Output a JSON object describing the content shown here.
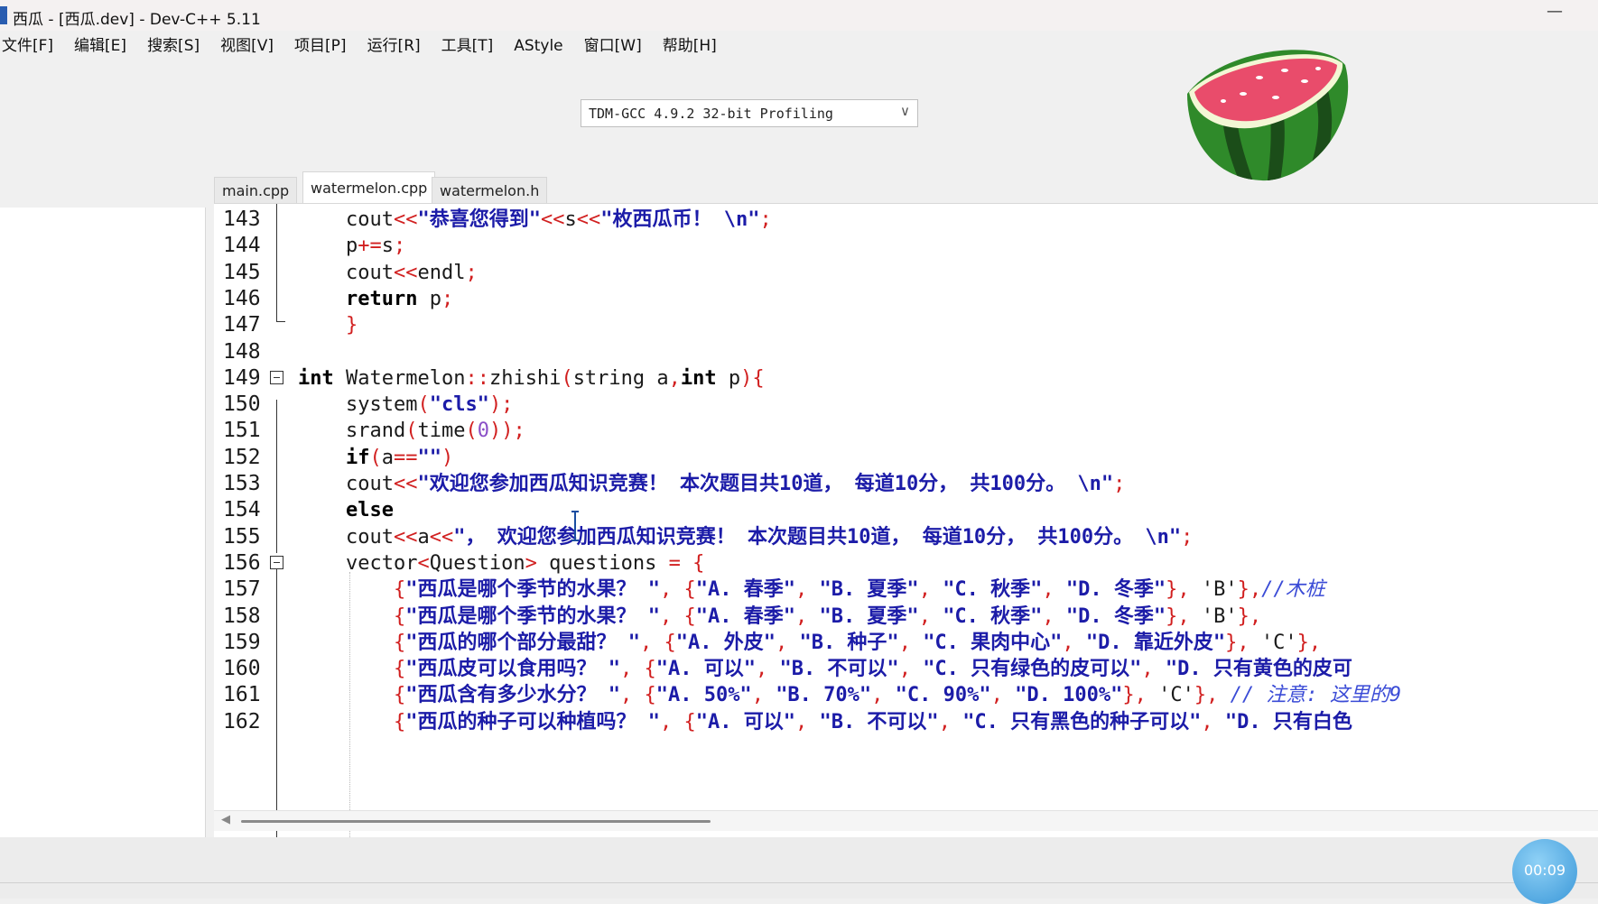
{
  "window": {
    "title": "西瓜 - [西瓜.dev] - Dev-C++ 5.11",
    "minimize": "—"
  },
  "menu": [
    "文件[F]",
    "编辑[E]",
    "搜索[S]",
    "视图[V]",
    "项目[P]",
    "运行[R]",
    "工具[T]",
    "AStyle",
    "窗口[W]",
    "帮助[H]"
  ],
  "compiler": {
    "selected": "TDM-GCC 4.9.2 32-bit Profiling",
    "arrow": "∨"
  },
  "tabs": [
    {
      "label": "main.cpp",
      "active": false
    },
    {
      "label": "watermelon.cpp",
      "active": true
    },
    {
      "label": "watermelon.h",
      "active": false
    }
  ],
  "code": [
    {
      "n": "143",
      "tokens": [
        [
          "t-id",
          "    cout"
        ],
        [
          "t-op",
          "<<"
        ],
        [
          "t-str",
          "\"恭喜您得到\""
        ],
        [
          "t-op",
          "<<"
        ],
        [
          "t-id",
          "s"
        ],
        [
          "t-op",
          "<<"
        ],
        [
          "t-str",
          "\"枚西瓜币！ \\n\""
        ],
        [
          "t-op",
          ";"
        ]
      ]
    },
    {
      "n": "144",
      "tokens": [
        [
          "t-id",
          "    p"
        ],
        [
          "t-op",
          "+="
        ],
        [
          "t-id",
          "s"
        ],
        [
          "t-op",
          ";"
        ]
      ]
    },
    {
      "n": "145",
      "tokens": [
        [
          "t-id",
          "    cout"
        ],
        [
          "t-op",
          "<<"
        ],
        [
          "t-id",
          "endl"
        ],
        [
          "t-op",
          ";"
        ]
      ]
    },
    {
      "n": "146",
      "tokens": [
        [
          "t-kw",
          "    return"
        ],
        [
          "t-id",
          " p"
        ],
        [
          "t-op",
          ";"
        ]
      ]
    },
    {
      "n": "147",
      "tokens": [
        [
          "t-op",
          "    }"
        ]
      ]
    },
    {
      "n": "148",
      "tokens": []
    },
    {
      "n": "149",
      "tokens": [
        [
          "t-kw",
          "int"
        ],
        [
          "t-id",
          " Watermelon"
        ],
        [
          "t-op",
          "::"
        ],
        [
          "t-id",
          "zhishi"
        ],
        [
          "t-op",
          "("
        ],
        [
          "t-id",
          "string a"
        ],
        [
          "t-op",
          ","
        ],
        [
          "t-kw",
          "int"
        ],
        [
          "t-id",
          " p"
        ],
        [
          "t-op",
          "){"
        ]
      ]
    },
    {
      "n": "150",
      "tokens": [
        [
          "t-id",
          "    system"
        ],
        [
          "t-op",
          "("
        ],
        [
          "t-str",
          "\"cls\""
        ],
        [
          "t-op",
          ");"
        ]
      ]
    },
    {
      "n": "151",
      "tokens": [
        [
          "t-id",
          "    srand"
        ],
        [
          "t-op",
          "("
        ],
        [
          "t-id",
          "time"
        ],
        [
          "t-op",
          "("
        ],
        [
          "t-num",
          "0"
        ],
        [
          "t-op",
          "));"
        ]
      ]
    },
    {
      "n": "152",
      "tokens": [
        [
          "t-kw",
          "    if"
        ],
        [
          "t-op",
          "("
        ],
        [
          "t-id",
          "a"
        ],
        [
          "t-op",
          "=="
        ],
        [
          "t-str",
          "\"\""
        ],
        [
          "t-op",
          ")"
        ]
      ]
    },
    {
      "n": "153",
      "tokens": [
        [
          "t-id",
          "    cout"
        ],
        [
          "t-op",
          "<<"
        ],
        [
          "t-str",
          "\"欢迎您参加西瓜知识竞赛！ 本次题目共10道， 每道10分， 共100分。 \\n\""
        ],
        [
          "t-op",
          ";"
        ]
      ]
    },
    {
      "n": "154",
      "tokens": [
        [
          "t-kw",
          "    else"
        ]
      ]
    },
    {
      "n": "155",
      "tokens": [
        [
          "t-id",
          "    cout"
        ],
        [
          "t-op",
          "<<"
        ],
        [
          "t-id",
          "a"
        ],
        [
          "t-op",
          "<<"
        ],
        [
          "t-str",
          "\"， 欢迎您参加西瓜知识竞赛！ 本次题目共10道， 每道10分， 共100分。 \\n\""
        ],
        [
          "t-op",
          ";"
        ]
      ]
    },
    {
      "n": "156",
      "tokens": [
        [
          "t-id",
          "    vector"
        ],
        [
          "t-op",
          "<"
        ],
        [
          "t-id",
          "Question"
        ],
        [
          "t-op",
          ">"
        ],
        [
          "t-id",
          " questions "
        ],
        [
          "t-op",
          "= {"
        ]
      ]
    },
    {
      "n": "157",
      "tokens": [
        [
          "t-op",
          "        {"
        ],
        [
          "t-str",
          "\"西瓜是哪个季节的水果？ \""
        ],
        [
          "t-op",
          ", {"
        ],
        [
          "t-str",
          "\"A. 春季\""
        ],
        [
          "t-op",
          ", "
        ],
        [
          "t-str",
          "\"B. 夏季\""
        ],
        [
          "t-op",
          ", "
        ],
        [
          "t-str",
          "\"C. 秋季\""
        ],
        [
          "t-op",
          ", "
        ],
        [
          "t-str",
          "\"D. 冬季\""
        ],
        [
          "t-op",
          "}, "
        ],
        [
          "t-id",
          "'B'"
        ],
        [
          "t-op",
          "},"
        ],
        [
          "t-cmt",
          "//木桩"
        ]
      ]
    },
    {
      "n": "158",
      "tokens": [
        [
          "t-op",
          "        {"
        ],
        [
          "t-str",
          "\"西瓜是哪个季节的水果？ \""
        ],
        [
          "t-op",
          ", {"
        ],
        [
          "t-str",
          "\"A. 春季\""
        ],
        [
          "t-op",
          ", "
        ],
        [
          "t-str",
          "\"B. 夏季\""
        ],
        [
          "t-op",
          ", "
        ],
        [
          "t-str",
          "\"C. 秋季\""
        ],
        [
          "t-op",
          ", "
        ],
        [
          "t-str",
          "\"D. 冬季\""
        ],
        [
          "t-op",
          "}, "
        ],
        [
          "t-id",
          "'B'"
        ],
        [
          "t-op",
          "},"
        ]
      ]
    },
    {
      "n": "159",
      "tokens": [
        [
          "t-op",
          "        {"
        ],
        [
          "t-str",
          "\"西瓜的哪个部分最甜？ \""
        ],
        [
          "t-op",
          ", {"
        ],
        [
          "t-str",
          "\"A. 外皮\""
        ],
        [
          "t-op",
          ", "
        ],
        [
          "t-str",
          "\"B. 种子\""
        ],
        [
          "t-op",
          ", "
        ],
        [
          "t-str",
          "\"C. 果肉中心\""
        ],
        [
          "t-op",
          ", "
        ],
        [
          "t-str",
          "\"D. 靠近外皮\""
        ],
        [
          "t-op",
          "}, "
        ],
        [
          "t-id",
          "'C'"
        ],
        [
          "t-op",
          "},"
        ]
      ]
    },
    {
      "n": "160",
      "tokens": [
        [
          "t-op",
          "        {"
        ],
        [
          "t-str",
          "\"西瓜皮可以食用吗？ \""
        ],
        [
          "t-op",
          ", {"
        ],
        [
          "t-str",
          "\"A. 可以\""
        ],
        [
          "t-op",
          ", "
        ],
        [
          "t-str",
          "\"B. 不可以\""
        ],
        [
          "t-op",
          ", "
        ],
        [
          "t-str",
          "\"C. 只有绿色的皮可以\""
        ],
        [
          "t-op",
          ", "
        ],
        [
          "t-str",
          "\"D. 只有黄色的皮可"
        ]
      ]
    },
    {
      "n": "161",
      "tokens": [
        [
          "t-op",
          "        {"
        ],
        [
          "t-str",
          "\"西瓜含有多少水分？ \""
        ],
        [
          "t-op",
          ", {"
        ],
        [
          "t-str",
          "\"A. 50%\""
        ],
        [
          "t-op",
          ", "
        ],
        [
          "t-str",
          "\"B. 70%\""
        ],
        [
          "t-op",
          ", "
        ],
        [
          "t-str",
          "\"C. 90%\""
        ],
        [
          "t-op",
          ", "
        ],
        [
          "t-str",
          "\"D. 100%\""
        ],
        [
          "t-op",
          "}, "
        ],
        [
          "t-id",
          "'C'"
        ],
        [
          "t-op",
          "}, "
        ],
        [
          "t-cmt",
          "// 注意: 这里的9"
        ]
      ]
    },
    {
      "n": "162",
      "tokens": [
        [
          "t-op",
          "        {"
        ],
        [
          "t-str",
          "\"西瓜的种子可以种植吗？ \""
        ],
        [
          "t-op",
          ", {"
        ],
        [
          "t-str",
          "\"A. 可以\""
        ],
        [
          "t-op",
          ", "
        ],
        [
          "t-str",
          "\"B. 不可以\""
        ],
        [
          "t-op",
          ", "
        ],
        [
          "t-str",
          "\"C. 只有黑色的种子可以\""
        ],
        [
          "t-op",
          ", "
        ],
        [
          "t-str",
          "\"D. 只有白色"
        ]
      ]
    }
  ],
  "timer": "00:09",
  "colors": {
    "string": "#1c1ca8",
    "operator": "#d11f1f",
    "number": "#8a4fc7",
    "comment": "#3a4bd6"
  }
}
